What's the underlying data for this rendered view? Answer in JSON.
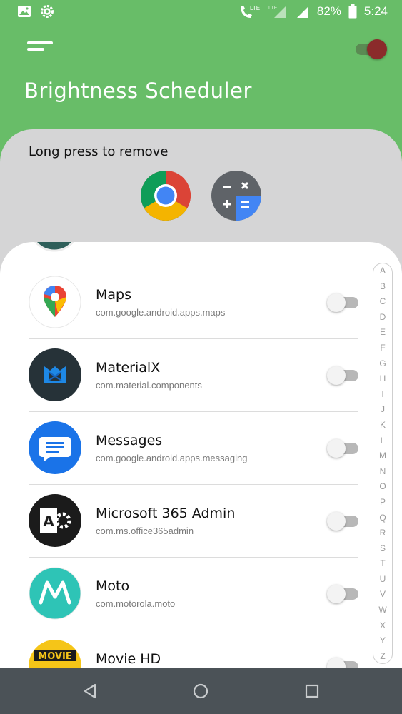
{
  "status_bar": {
    "battery": "82%",
    "time": "5:24",
    "network": "LTE"
  },
  "header": {
    "title": "Brightness Scheduler",
    "master_toggle": "on"
  },
  "favorites": {
    "label": "Long press to remove",
    "apps": [
      "chrome-icon",
      "calculator-icon"
    ]
  },
  "apps": [
    {
      "name": "Maps",
      "package": "com.google.android.apps.maps",
      "enabled": false
    },
    {
      "name": "MaterialX",
      "package": "com.material.components",
      "enabled": false
    },
    {
      "name": "Messages",
      "package": "com.google.android.apps.messaging",
      "enabled": false
    },
    {
      "name": "Microsoft 365 Admin",
      "package": "com.ms.office365admin",
      "enabled": false
    },
    {
      "name": "Moto",
      "package": "com.motorola.moto",
      "enabled": false
    },
    {
      "name": "Movie HD",
      "package": "",
      "enabled": false
    }
  ],
  "alphabet": [
    "A",
    "B",
    "C",
    "D",
    "E",
    "F",
    "G",
    "H",
    "I",
    "J",
    "K",
    "L",
    "M",
    "N",
    "O",
    "P",
    "Q",
    "R",
    "S",
    "T",
    "U",
    "V",
    "W",
    "X",
    "Y",
    "Z"
  ],
  "colors": {
    "header_green": "#68bd68",
    "panel_gray": "#d5d5d6",
    "nav_bar": "#4b5257",
    "toggle_on_knob": "#8b2b2b"
  }
}
